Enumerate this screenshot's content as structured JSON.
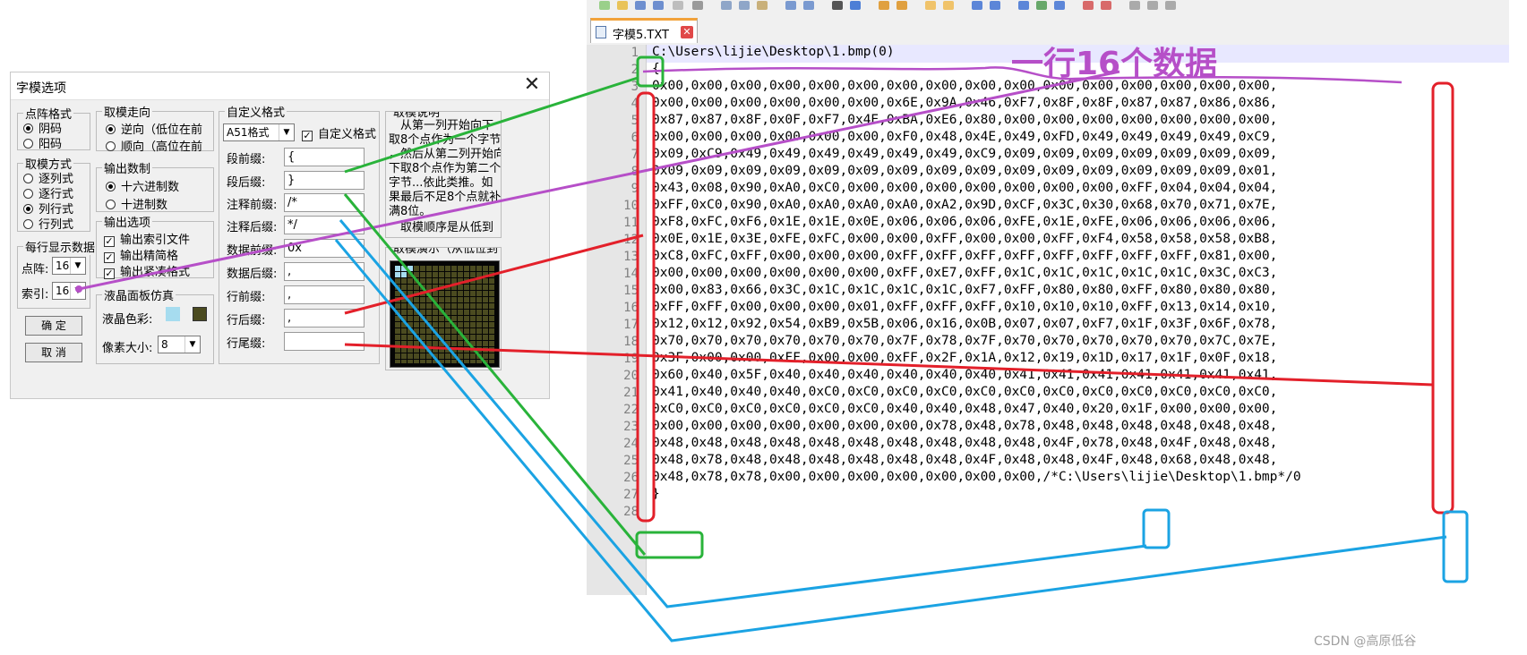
{
  "editor": {
    "tab_title": "字模5.TXT",
    "tab_close_glyph": "✕",
    "line_numbers": [
      "1",
      "2",
      "3",
      "4",
      "5",
      "6",
      "7",
      "8",
      "9",
      "10",
      "11",
      "12",
      "13",
      "14",
      "15",
      "16",
      "17",
      "18",
      "19",
      "20",
      "21",
      "22",
      "23",
      "24",
      "25",
      "26",
      "27",
      "28"
    ],
    "lines": [
      "C:\\Users\\lijie\\Desktop\\1.bmp(0)",
      "{",
      "0x00,0x00,0x00,0x00,0x00,0x00,0x00,0x00,0x00,0x00,0x00,0x00,0x00,0x00,0x00,0x00,",
      "0x00,0x00,0x00,0x00,0x00,0x00,0x6E,0x9A,0x46,0xF7,0x8F,0x8F,0x87,0x87,0x86,0x86,",
      "0x87,0x87,0x8F,0x0F,0xF7,0x4E,0xBA,0xE6,0x80,0x00,0x00,0x00,0x00,0x00,0x00,0x00,",
      "0x00,0x00,0x00,0x00,0x00,0x00,0xF0,0x48,0x4E,0x49,0xFD,0x49,0x49,0x49,0x49,0xC9,",
      "0x09,0xC9,0x49,0x49,0x49,0x49,0x49,0x49,0xC9,0x09,0x09,0x09,0x09,0x09,0x09,0x09,",
      "0x09,0x09,0x09,0x09,0x09,0x09,0x09,0x09,0x09,0x09,0x09,0x09,0x09,0x09,0x09,0x01,",
      "0x43,0x08,0x90,0xA0,0xC0,0x00,0x00,0x00,0x00,0x00,0x00,0x00,0xFF,0x04,0x04,0x04,",
      "0xFF,0xC0,0x90,0xA0,0xA0,0xA0,0xA0,0xA2,0x9D,0xCF,0x3C,0x30,0x68,0x70,0x71,0x7E,",
      "0xF8,0xFC,0xF6,0x1E,0x1E,0x0E,0x06,0x06,0x06,0xFE,0x1E,0xFE,0x06,0x06,0x06,0x06,",
      "0x0E,0x1E,0x3E,0xFE,0xFC,0x00,0x00,0xFF,0x00,0x00,0xFF,0xF4,0x58,0x58,0x58,0xB8,",
      "0xC8,0xFC,0xFF,0x00,0x00,0x00,0xFF,0xFF,0xFF,0xFF,0xFF,0xFF,0xFF,0xFF,0x81,0x00,",
      "0x00,0x00,0x00,0x00,0x00,0x00,0xFF,0xE7,0xFF,0x1C,0x1C,0x1C,0x1C,0x1C,0x3C,0xC3,",
      "0x00,0x83,0x66,0x3C,0x1C,0x1C,0x1C,0x1C,0xF7,0xFF,0x80,0x80,0xFF,0x80,0x80,0x80,",
      "0xFF,0xFF,0x00,0x00,0x00,0x01,0xFF,0xFF,0xFF,0x10,0x10,0x10,0xFF,0x13,0x14,0x10,",
      "0x12,0x12,0x92,0x54,0xB9,0x5B,0x06,0x16,0x0B,0x07,0x07,0xF7,0x1F,0x3F,0x6F,0x78,",
      "0x70,0x70,0x70,0x70,0x70,0x70,0x7F,0x78,0x7F,0x70,0x70,0x70,0x70,0x70,0x7C,0x7E,",
      "0x3F,0x00,0x00,0xFF,0x00,0x00,0xFF,0x2F,0x1A,0x12,0x19,0x1D,0x17,0x1F,0x0F,0x18,",
      "0x60,0x40,0x5F,0x40,0x40,0x40,0x40,0x40,0x40,0x41,0x41,0x41,0x41,0x41,0x41,0x41,",
      "0x41,0x40,0x40,0x40,0xC0,0xC0,0xC0,0xC0,0xC0,0xC0,0xC0,0xC0,0xC0,0xC0,0xC0,0xC0,",
      "0xC0,0xC0,0xC0,0xC0,0xC0,0xC0,0x40,0x40,0x48,0x47,0x40,0x20,0x1F,0x00,0x00,0x00,",
      "0x00,0x00,0x00,0x00,0x00,0x00,0x00,0x78,0x48,0x78,0x48,0x48,0x48,0x48,0x48,0x48,",
      "0x48,0x48,0x48,0x48,0x48,0x48,0x48,0x48,0x48,0x48,0x4F,0x78,0x48,0x4F,0x48,0x48,",
      "0x48,0x78,0x48,0x48,0x48,0x48,0x48,0x48,0x4F,0x48,0x48,0x4F,0x48,0x68,0x48,0x48,",
      "0x48,0x78,0x78,0x00,0x00,0x00,0x00,0x00,0x00,0x00,/*C:\\Users\\lijie\\Desktop\\1.bmp*/0",
      "}",
      ""
    ]
  },
  "dialog": {
    "title": "字模选项",
    "close_glyph": "✕",
    "dot_format": {
      "title": "点阵格式",
      "options": [
        "阴码",
        "阳码"
      ],
      "checked": [
        true,
        false
      ]
    },
    "scan_mode": {
      "title": "取模方式",
      "options": [
        "逐列式",
        "逐行式",
        "列行式",
        "行列式"
      ],
      "checked": [
        false,
        false,
        true,
        false
      ]
    },
    "per_line": {
      "title": "每行显示数据",
      "dots_label": "点阵:",
      "dots_value": "16",
      "index_label": "索引:",
      "index_value": "16"
    },
    "buttons": {
      "confirm": "确 定",
      "cancel": "取 消"
    },
    "direction": {
      "title": "取模走向",
      "options": [
        "逆向（低位在前",
        "顺向（高位在前"
      ],
      "checked": [
        true,
        false
      ]
    },
    "number_format": {
      "title": "输出数制",
      "options": [
        "十六进制数",
        "十进制数"
      ],
      "checked": [
        true,
        false
      ]
    },
    "output_options": {
      "title": "输出选项",
      "options": [
        "输出索引文件",
        "输出精简格",
        "输出紧凑格式"
      ],
      "checked": [
        true,
        true,
        true
      ]
    },
    "lcd": {
      "title": "液晶面板仿真",
      "color_label": "液晶色彩:",
      "pixel_label": "像素大小:",
      "pixel_value": "8"
    },
    "custom_format": {
      "title": "自定义格式",
      "preset": "A51格式",
      "custom_check_label": "自定义格式",
      "fields": [
        {
          "label": "段前缀:",
          "value": "{"
        },
        {
          "label": "段后缀:",
          "value": "}"
        },
        {
          "label": "注释前缀:",
          "value": "/*"
        },
        {
          "label": "注释后缀:",
          "value": "*/"
        },
        {
          "label": "数据前缀:",
          "value": "0x"
        },
        {
          "label": "数据后缀:",
          "value": ","
        },
        {
          "label": "行前缀:",
          "value": ","
        },
        {
          "label": "行后缀:",
          "value": ","
        },
        {
          "label": "行尾缀:",
          "value": ""
        }
      ]
    },
    "explanation": {
      "title": "取模说明",
      "lines": [
        "从第一列开始向下",
        "取8个点作为一个字节",
        "，然后从第二列开始向",
        "下取8个点作为第二个",
        "字节...依此类推。如",
        "果最后不足8个点就补",
        "满8位。",
        "取模顺序是从低到"
      ]
    },
    "demo": {
      "title": "取模演示（从低位到"
    }
  },
  "annotation": {
    "text": "一行16个数据"
  },
  "watermark": "CSDN @高原低谷",
  "colors": {
    "purple": "#b64fc8",
    "green": "#29b33a",
    "red": "#e3202a",
    "blue": "#1ba3e3",
    "lcd_fg": "#a6dcef",
    "lcd_bg": "#4b4b20"
  }
}
